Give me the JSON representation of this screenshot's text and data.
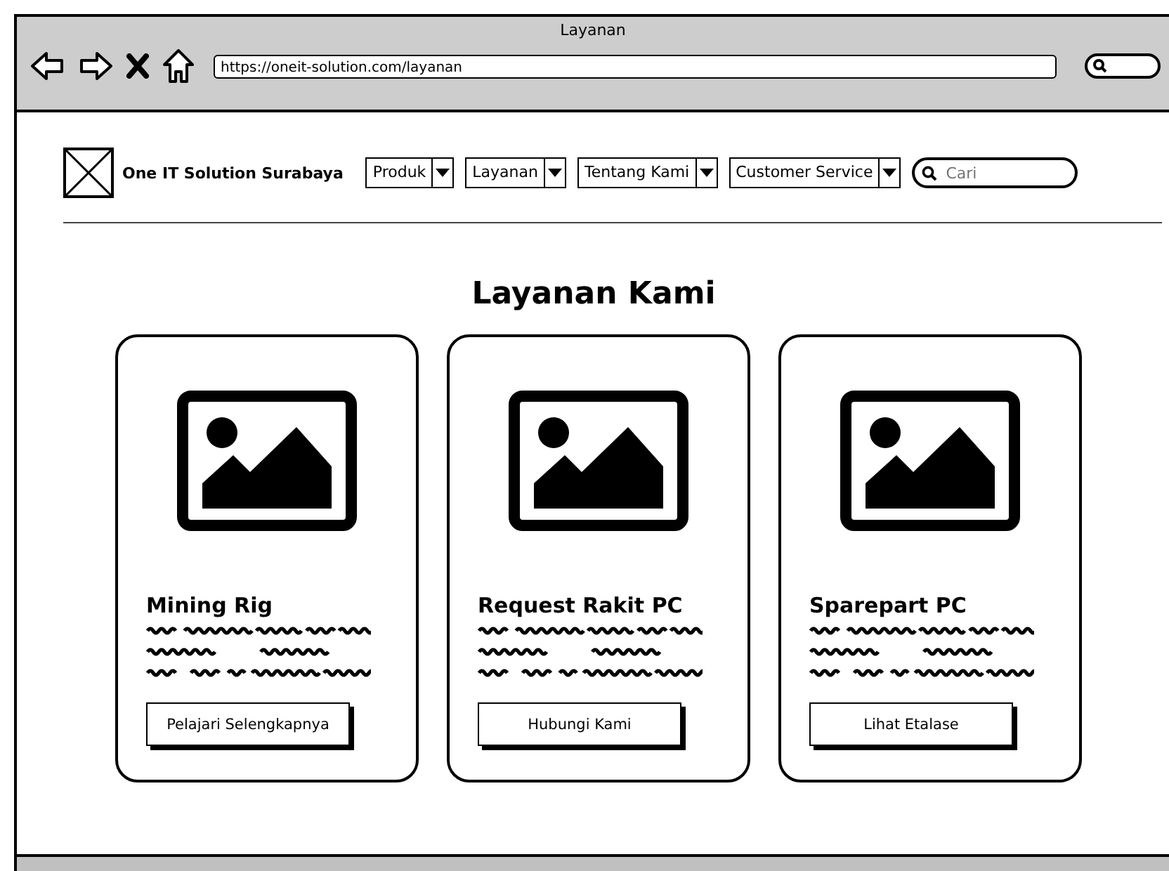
{
  "window": {
    "title": "Layanan",
    "url": "https://oneit-solution.com/layanan"
  },
  "navbar": {
    "brand": "One IT Solution Surabaya",
    "menus": [
      {
        "label": "Produk"
      },
      {
        "label": "Layanan"
      },
      {
        "label": "Tentang Kami"
      },
      {
        "label": "Customer Service"
      }
    ],
    "search": {
      "placeholder": "Cari"
    }
  },
  "heading": "Layanan Kami",
  "cards": [
    {
      "title": "Mining Rig",
      "button": "Pelajari Selengkapnya"
    },
    {
      "title": "Request Rakit PC",
      "button": "Hubungi Kami"
    },
    {
      "title": "Sparepart PC",
      "button": "Lihat Etalase"
    }
  ]
}
